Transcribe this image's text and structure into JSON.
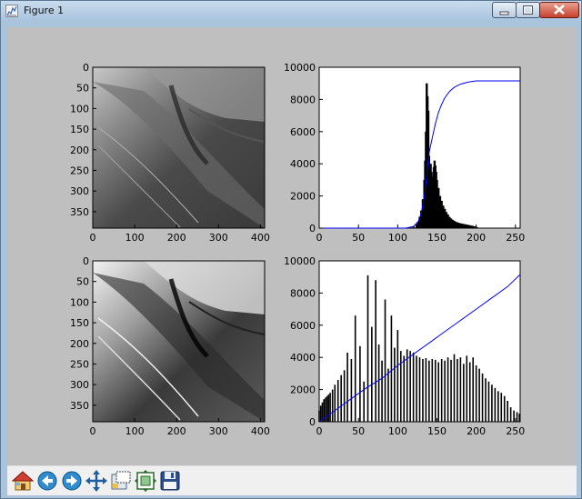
{
  "window": {
    "title": "Figure 1",
    "icon": "matplotlib-figure-icon"
  },
  "title_buttons": [
    {
      "name": "minimize-button",
      "icon": "minimize-icon"
    },
    {
      "name": "maximize-button",
      "icon": "maximize-icon"
    },
    {
      "name": "close-button",
      "icon": "close-icon"
    }
  ],
  "toolbar": {
    "items": [
      {
        "name": "home-button",
        "icon": "home-icon"
      },
      {
        "name": "back-button",
        "icon": "back-arrow-icon"
      },
      {
        "name": "forward-button",
        "icon": "forward-arrow-icon"
      },
      {
        "name": "pan-button",
        "icon": "pan-move-icon"
      },
      {
        "name": "zoom-button",
        "icon": "zoom-rect-icon"
      },
      {
        "name": "subplots-button",
        "icon": "subplots-icon"
      },
      {
        "name": "save-button",
        "icon": "save-icon"
      }
    ]
  },
  "colors": {
    "cdf_line": "#0000ff",
    "hist_bars": "#000000",
    "figure_bg": "#bfbfbf",
    "axes_bg": "#ffffff"
  },
  "chart_data": [
    {
      "type": "image",
      "panel": "top-left",
      "description_visible": "grayscale photo",
      "x_ticks": [
        "0",
        "100",
        "200",
        "300",
        "400"
      ],
      "y_ticks": [
        "0",
        "50",
        "100",
        "150",
        "200",
        "250",
        "300",
        "350"
      ]
    },
    {
      "type": "bar",
      "panel": "top-right",
      "x_ticks": [
        "0",
        "50",
        "100",
        "150",
        "200",
        "250"
      ],
      "y_ticks": [
        "0",
        "2000",
        "4000",
        "6000",
        "8000",
        "10000"
      ],
      "xlim": [
        0,
        256
      ],
      "ylim": [
        0,
        10000
      ],
      "histogram": {
        "x": [
          112,
          116,
          120,
          124,
          126,
          128,
          130,
          132,
          134,
          135,
          136,
          137,
          138,
          139,
          140,
          141,
          142,
          143,
          144,
          145,
          146,
          147,
          148,
          149,
          150,
          152,
          154,
          156,
          158,
          160,
          162,
          164,
          166,
          168,
          170,
          172,
          174,
          176,
          178,
          180,
          182,
          184,
          186,
          188,
          190,
          192,
          194,
          196,
          198,
          200,
          202
        ],
        "y": [
          30,
          60,
          120,
          250,
          400,
          700,
          1100,
          1800,
          3000,
          4200,
          6000,
          9000,
          8200,
          7300,
          4500,
          3800,
          4000,
          3500,
          3000,
          3200,
          3800,
          4200,
          3900,
          3500,
          3000,
          2500,
          2000,
          1700,
          1400,
          1200,
          1000,
          850,
          700,
          600,
          520,
          460,
          400,
          360,
          330,
          300,
          280,
          260,
          240,
          220,
          200,
          180,
          160,
          140,
          110,
          80,
          40
        ]
      },
      "cdf": {
        "x": [
          0,
          110,
          120,
          126,
          130,
          134,
          136,
          138,
          140,
          144,
          148,
          152,
          156,
          160,
          166,
          172,
          180,
          190,
          200,
          256
        ],
        "y": [
          0,
          0,
          100,
          400,
          900,
          2000,
          2800,
          3800,
          4700,
          5600,
          6500,
          7200,
          7700,
          8100,
          8500,
          8750,
          8950,
          9080,
          9150,
          9150
        ]
      }
    },
    {
      "type": "image",
      "panel": "bottom-left",
      "description_visible": "equalized grayscale photo",
      "x_ticks": [
        "0",
        "100",
        "200",
        "300",
        "400"
      ],
      "y_ticks": [
        "0",
        "50",
        "100",
        "150",
        "200",
        "250",
        "300",
        "350"
      ]
    },
    {
      "type": "bar",
      "panel": "bottom-right",
      "x_ticks": [
        "0",
        "50",
        "100",
        "150",
        "200",
        "250"
      ],
      "y_ticks": [
        "0",
        "2000",
        "4000",
        "6000",
        "8000",
        "10000"
      ],
      "xlim": [
        0,
        256
      ],
      "ylim": [
        0,
        10000
      ],
      "histogram": {
        "x": [
          0,
          2,
          4,
          6,
          8,
          10,
          12,
          14,
          17,
          20,
          24,
          28,
          32,
          36,
          41,
          46,
          52,
          57,
          62,
          67,
          72,
          76,
          80,
          84,
          88,
          92,
          96,
          100,
          104,
          108,
          112,
          116,
          120,
          124,
          128,
          132,
          136,
          140,
          144,
          148,
          152,
          156,
          160,
          164,
          168,
          172,
          176,
          180,
          184,
          188,
          192,
          196,
          200,
          204,
          208,
          212,
          216,
          220,
          224,
          228,
          232,
          236,
          240,
          244,
          248,
          252,
          255
        ],
        "y": [
          700,
          1000,
          1200,
          1400,
          1500,
          1600,
          1700,
          1800,
          2000,
          2300,
          2600,
          2900,
          3200,
          4300,
          3900,
          6600,
          4700,
          2500,
          9100,
          5900,
          8800,
          4800,
          3800,
          7600,
          3300,
          6600,
          4600,
          5700,
          4400,
          4100,
          4500,
          4400,
          4300,
          4100,
          4000,
          3900,
          3950,
          3800,
          3900,
          3850,
          3700,
          3900,
          3800,
          4000,
          3850,
          4200,
          3900,
          4000,
          3600,
          4100,
          3700,
          4000,
          3500,
          3300,
          3000,
          2700,
          2500,
          2300,
          2100,
          1900,
          1800,
          1600,
          1300,
          900,
          700,
          600,
          500
        ]
      },
      "cdf": {
        "x": [
          0,
          20,
          40,
          60,
          80,
          100,
          120,
          140,
          160,
          180,
          200,
          220,
          240,
          256
        ],
        "y": [
          0,
          700,
          1400,
          2100,
          2700,
          3500,
          4200,
          4900,
          5600,
          6300,
          7000,
          7700,
          8400,
          9150
        ]
      }
    }
  ]
}
